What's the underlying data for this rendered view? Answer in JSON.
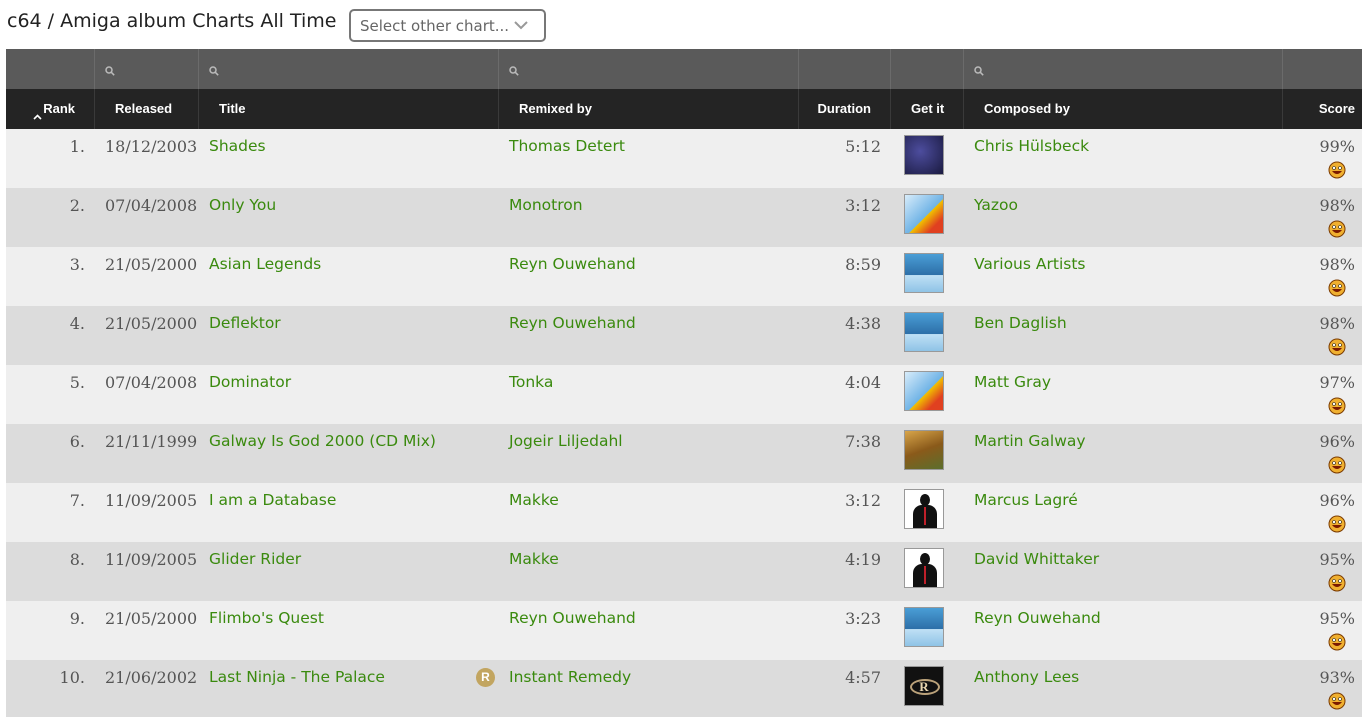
{
  "page": {
    "title": "c64 / Amiga album Charts All Time"
  },
  "chart_select": {
    "placeholder": "Select other chart..."
  },
  "icons": {
    "filter": "search-icon",
    "sort": "sort-ascending-icon",
    "dropdown": "chevron-down-icon",
    "score": "smiley-face-icon",
    "remix": "remix-badge-icon"
  },
  "colors": {
    "link": "#3a8a0e",
    "header_bg": "#242424",
    "filter_bg": "#5a5a5a",
    "row_odd": "#efefef",
    "row_even": "#dcdcdc",
    "badge": "#c2a560"
  },
  "columns": {
    "rank": "Rank",
    "released": "Released",
    "title": "Title",
    "remixed_by": "Remixed by",
    "duration": "Duration",
    "get_it": "Get it",
    "composed_by": "Composed by",
    "score": "Score"
  },
  "rows": [
    {
      "rank": "1.",
      "released": "18/12/2003",
      "title": "Shades",
      "remixed_by": "Thomas Detert",
      "duration": "5:12",
      "cover": "album-cover-v2-icon",
      "composed_by": "Chris Hülsbeck",
      "score": "99%"
    },
    {
      "rank": "2.",
      "released": "07/04/2008",
      "title": "Only You",
      "remixed_by": "Monotron",
      "duration": "3:12",
      "cover": "album-cover-stairs-icon",
      "composed_by": "Yazoo",
      "score": "98%"
    },
    {
      "rank": "3.",
      "released": "21/05/2000",
      "title": "Asian Legends",
      "remixed_by": "Reyn Ouwehand",
      "duration": "8:59",
      "cover": "album-cover-blue-icon",
      "composed_by": "Various Artists",
      "score": "98%"
    },
    {
      "rank": "4.",
      "released": "21/05/2000",
      "title": "Deflektor",
      "remixed_by": "Reyn Ouwehand",
      "duration": "4:38",
      "cover": "album-cover-blue-icon",
      "composed_by": "Ben Daglish",
      "score": "98%"
    },
    {
      "rank": "5.",
      "released": "07/04/2008",
      "title": "Dominator",
      "remixed_by": "Tonka",
      "duration": "4:04",
      "cover": "album-cover-stairs-icon",
      "composed_by": "Matt Gray",
      "score": "97%"
    },
    {
      "rank": "6.",
      "released": "21/11/1999",
      "title": "Galway Is God 2000 (CD Mix)",
      "remixed_by": "Jogeir Liljedahl",
      "duration": "7:38",
      "cover": "album-cover-galway-icon",
      "composed_by": "Martin Galway",
      "score": "96%"
    },
    {
      "rank": "7.",
      "released": "11/09/2005",
      "title": "I am a Database",
      "remixed_by": "Makke",
      "duration": "3:12",
      "cover": "album-cover-person-icon",
      "composed_by": "Marcus Lagré",
      "score": "96%"
    },
    {
      "rank": "8.",
      "released": "11/09/2005",
      "title": "Glider Rider",
      "remixed_by": "Makke",
      "duration": "4:19",
      "cover": "album-cover-person-icon",
      "composed_by": "David Whittaker",
      "score": "95%"
    },
    {
      "rank": "9.",
      "released": "21/05/2000",
      "title": "Flimbo's Quest",
      "remixed_by": "Reyn Ouwehand",
      "duration": "3:23",
      "cover": "album-cover-blue-icon",
      "composed_by": "Reyn Ouwehand",
      "score": "95%"
    },
    {
      "rank": "10.",
      "released": "21/06/2002",
      "title": "Last Ninja - The Palace",
      "title_badge": "R",
      "remixed_by": "Instant Remedy",
      "duration": "4:57",
      "cover": "album-cover-remedy-icon",
      "composed_by": "Anthony Lees",
      "score": "93%"
    }
  ]
}
